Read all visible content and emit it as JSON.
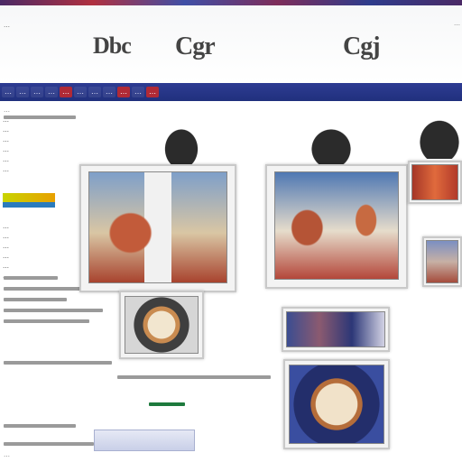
{
  "header": {
    "site_title": "…",
    "logos": [
      "Dbc",
      "Cgr",
      "Cgj"
    ],
    "right_text": "…"
  },
  "nav": {
    "items": [
      {
        "label": "…"
      },
      {
        "label": "…"
      },
      {
        "label": "…"
      },
      {
        "label": "…"
      },
      {
        "label": "…"
      },
      {
        "label": "…"
      },
      {
        "label": "…"
      },
      {
        "label": "…"
      },
      {
        "label": "…"
      },
      {
        "label": "…"
      },
      {
        "label": "…"
      }
    ],
    "highlight_index": 4
  },
  "breadcrumb": "…",
  "sidebar": {
    "links": [
      "…",
      "…",
      "…",
      "…",
      "…",
      "…",
      "…",
      "…",
      "…",
      "…",
      "…",
      "…"
    ]
  },
  "cards": [
    {
      "name": "card-1",
      "label": ""
    },
    {
      "name": "card-2",
      "label": ""
    },
    {
      "name": "card-3",
      "label": ""
    },
    {
      "name": "card-4",
      "label": ""
    },
    {
      "name": "card-5",
      "label": ""
    },
    {
      "name": "card-6",
      "label": ""
    },
    {
      "name": "card-7",
      "label": ""
    }
  ],
  "footer_note": "…",
  "colors": {
    "nav_bg": "#2e3c93",
    "nav_highlight": "#b02a36",
    "accent_red": "#b03040"
  }
}
